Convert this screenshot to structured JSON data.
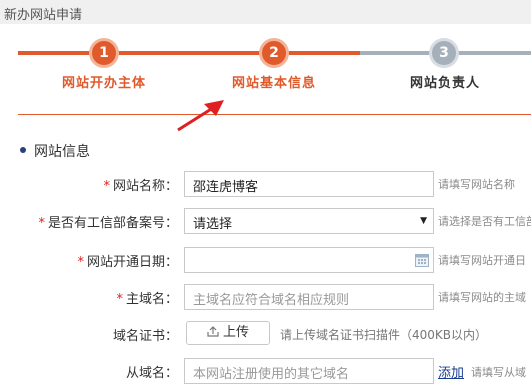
{
  "window": {
    "title": "新办网站申请"
  },
  "steps": [
    {
      "number": "1",
      "label": "网站开办主体"
    },
    {
      "number": "2",
      "label": "网站基本信息"
    },
    {
      "number": "3",
      "label": "网站负责人"
    }
  ],
  "colors": {
    "active": "#e05a2b",
    "inactive": "#a6b0ba",
    "required": "#e02020",
    "link": "#1a3d8f"
  },
  "section": {
    "title": "网站信息"
  },
  "form": {
    "site_name": {
      "required": "*",
      "label": "网站名称：",
      "value": "邵连虎博客",
      "hint": "请填写网站名称"
    },
    "icp": {
      "required": "*",
      "label": "是否有工信部备案号：",
      "value": "请选择",
      "arrow": "▼",
      "hint": "请选择是否有工信部"
    },
    "open_date": {
      "required": "*",
      "label": "网站开通日期：",
      "value": "",
      "hint": "请填写网站开通日"
    },
    "main_domain": {
      "required": "*",
      "label": "主域名：",
      "placeholder": "主域名应符合域名相应规则",
      "hint": "请填写网站的主域"
    },
    "domain_cert": {
      "label": "域名证书：",
      "button": "上传",
      "hint": "请上传域名证书扫描件（400KB以内）"
    },
    "sub_domain": {
      "label": "从域名：",
      "placeholder": "本网站注册使用的其它域名",
      "add": "添加",
      "hint": "请填写从域"
    }
  }
}
